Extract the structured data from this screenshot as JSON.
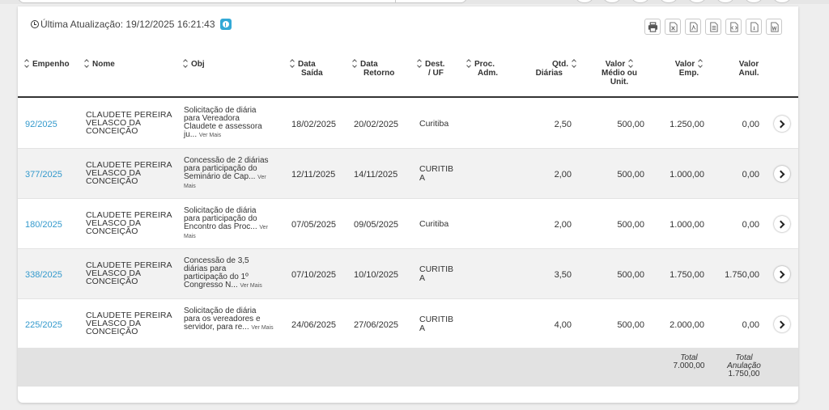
{
  "last_update": {
    "label": "Última Atualização:",
    "value": "19/12/2025 16:21:43"
  },
  "toolbar": [
    "print-icon",
    "excel-icon",
    "pdf-icon",
    "csv-icon",
    "xml-icon",
    "json-icon",
    "word-icon"
  ],
  "headers": {
    "empenho": "Empenho",
    "nome": "Nome",
    "obj": "Obj",
    "data_saida": [
      "Data",
      "Saída"
    ],
    "data_retorno": [
      "Data",
      "Retorno"
    ],
    "dest": [
      "Dest.",
      "/ UF"
    ],
    "proc": [
      "Proc.",
      "Adm."
    ],
    "qtd": [
      "Qtd.",
      "Diárias"
    ],
    "valor_medio": [
      "Valor",
      "Médio ou",
      "Unit."
    ],
    "valor_emp": [
      "Valor",
      "Emp."
    ],
    "valor_anul": [
      "Valor",
      "Anul."
    ]
  },
  "ver_mais": "Ver Mais",
  "rows": [
    {
      "empenho": "92/2025",
      "nome": [
        "CLAUDETE PEREIRA",
        "VELASCO DA",
        "CONCEIÇÃO"
      ],
      "obj": [
        "Solicitação de diária",
        "para Vereadora",
        "Claudete e assessora",
        "ju..."
      ],
      "data_saida": "18/02/2025",
      "data_retorno": "20/02/2025",
      "dest": [
        "Curitiba"
      ],
      "proc": "",
      "qtd": "2,50",
      "valor_medio": "500,00",
      "valor_emp": "1.250,00",
      "valor_anul": "0,00"
    },
    {
      "empenho": "377/2025",
      "nome": [
        "CLAUDETE PEREIRA",
        "VELASCO DA",
        "CONCEIÇÃO"
      ],
      "obj": [
        "Concessão de 2 diárias",
        "para participação do",
        "Seminário de Cap..."
      ],
      "data_saida": "12/11/2025",
      "data_retorno": "14/11/2025",
      "dest": [
        "CURITIB",
        "A"
      ],
      "proc": "",
      "qtd": "2,00",
      "valor_medio": "500,00",
      "valor_emp": "1.000,00",
      "valor_anul": "0,00"
    },
    {
      "empenho": "180/2025",
      "nome": [
        "CLAUDETE PEREIRA",
        "VELASCO DA",
        "CONCEIÇÃO"
      ],
      "obj": [
        "Solicitação de diária",
        "para participação do",
        "Encontro das Proc..."
      ],
      "data_saida": "07/05/2025",
      "data_retorno": "09/05/2025",
      "dest": [
        "Curitiba"
      ],
      "proc": "",
      "qtd": "2,00",
      "valor_medio": "500,00",
      "valor_emp": "1.000,00",
      "valor_anul": "0,00"
    },
    {
      "empenho": "338/2025",
      "nome": [
        "CLAUDETE PEREIRA",
        "VELASCO DA",
        "CONCEIÇÃO"
      ],
      "obj": [
        "Concessão de 3,5",
        "diárias para",
        "participação do 1º",
        "Congresso N..."
      ],
      "data_saida": "07/10/2025",
      "data_retorno": "10/10/2025",
      "dest": [
        "CURITIB",
        "A"
      ],
      "proc": "",
      "qtd": "3,50",
      "valor_medio": "500,00",
      "valor_emp": "1.750,00",
      "valor_anul": "1.750,00"
    },
    {
      "empenho": "225/2025",
      "nome": [
        "CLAUDETE PEREIRA",
        "VELASCO DA",
        "CONCEIÇÃO"
      ],
      "obj": [
        "Solicitação de diária",
        "para os vereadores e",
        "servidor, para re..."
      ],
      "data_saida": "24/06/2025",
      "data_retorno": "27/06/2025",
      "dest": [
        "CURITIB",
        "A"
      ],
      "proc": "",
      "qtd": "4,00",
      "valor_medio": "500,00",
      "valor_emp": "2.000,00",
      "valor_anul": "0,00"
    }
  ],
  "totals": {
    "emp": {
      "label": "Total",
      "value": "7.000,00"
    },
    "anul": {
      "label": [
        "Total",
        "Anulação"
      ],
      "value": "1.750,00"
    }
  }
}
